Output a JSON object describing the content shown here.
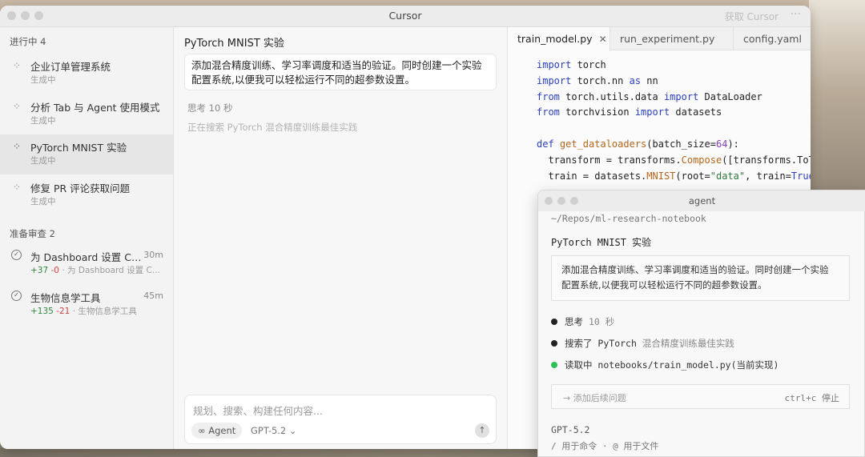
{
  "window": {
    "title": "Cursor",
    "top_right": "获取 Cursor",
    "more": "···"
  },
  "sidebar": {
    "in_progress_label": "进行中 4",
    "in_progress": [
      {
        "title": "企业订单管理系统",
        "status": "生成中"
      },
      {
        "title": "分析 Tab 与 Agent 使用模式",
        "status": "生成中"
      },
      {
        "title": "PyTorch MNIST 实验",
        "status": "生成中"
      },
      {
        "title": "修复 PR 评论获取问题",
        "status": "生成中"
      }
    ],
    "review_label": "准备审查 2",
    "review": [
      {
        "title": "为 Dashboard 设置 Cu...",
        "time": "30m",
        "add": "+37",
        "del": "-0",
        "desc": "· 为 Dashboard 设置 C..."
      },
      {
        "title": "生物信息学工具",
        "time": "45m",
        "add": "+135",
        "del": "-21",
        "desc": "· 生物信息学工具"
      }
    ]
  },
  "chat": {
    "title": "PyTorch MNIST 实验",
    "message_line1": "添加混合精度训练、学习率调度和适当的验证。同时创建一个实验",
    "message_line2": "配置系统,以便我可以轻松运行不同的超参数设置。",
    "thinking": "思考 10 秒",
    "searching": "正在搜索 PyTorch 混合精度训练最佳实践",
    "composer_placeholder": "规划、搜索、构建任何内容...",
    "mode": "Agent",
    "model": "GPT-5.2"
  },
  "editor": {
    "tabs": [
      {
        "label": "train_model.py",
        "close": "✕"
      },
      {
        "label": "run_experiment.py"
      },
      {
        "label": "config.yaml"
      }
    ],
    "code": {
      "l1a": "import",
      "l1b": " torch",
      "l2a": "import",
      "l2b": " torch.nn ",
      "l2c": "as",
      "l2d": " nn",
      "l3a": "from",
      "l3b": " torch.utils.data ",
      "l3c": "import",
      "l3d": " DataLoader",
      "l4a": "from",
      "l4b": " torchvision ",
      "l4c": "import",
      "l4d": " datasets",
      "l6a": "def",
      "l6b": " get_dataloaders",
      "l6c": "(batch_size=",
      "l6d": "64",
      "l6e": "):",
      "l7a": "  transform = transforms.",
      "l7b": "Compose",
      "l7c": "([transforms.ToTe",
      "l8a": "  train = datasets.",
      "l8b": "MNIST",
      "l8c": "(root=",
      "l8d": "\"data\"",
      "l8e": ", train=",
      "l8f": "True"
    }
  },
  "terminal": {
    "title": "agent",
    "path": "~/Repos/ml-research-notebook",
    "heading": "PyTorch MNIST 实验",
    "message_line1": "添加混合精度训练、学习率调度和适当的验证。同时创建一个实验",
    "message_line2": "配置系统,以便我可以轻松运行不同的超参数设置。",
    "step1": "思考",
    "step1_meta": "10 秒",
    "step2": "搜索了 PyTorch",
    "step2_meta": "混合精度训练最佳实践",
    "step3": "读取中 notebooks/train_model.py(当前实现)",
    "input_placeholder": "→ 添加后续问题",
    "stop": "ctrl+c 停止",
    "model": "GPT-5.2",
    "hint": "/ 用于命令 · @ 用于文件"
  }
}
